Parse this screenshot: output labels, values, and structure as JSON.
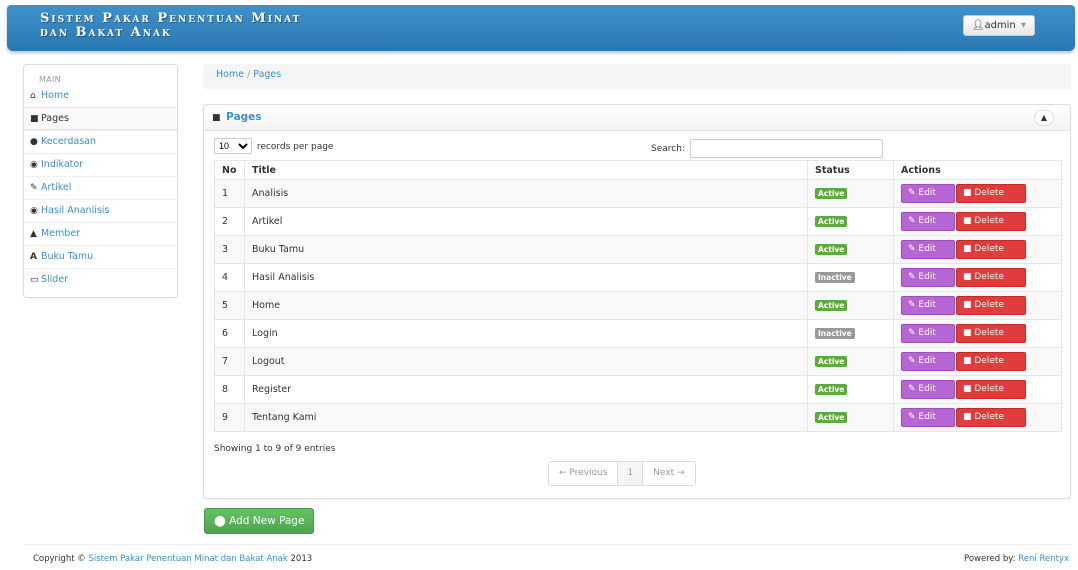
{
  "header": {
    "title_line1": "Sistem Pakar Penentuan Minat",
    "title_line2": "dan Bakat Anak",
    "user_label": "admin",
    "user_icon": "user-icon",
    "caret": "▾"
  },
  "sidebar": {
    "heading": "MAIN",
    "items": [
      {
        "label": "Home",
        "icon": "home-icon"
      },
      {
        "label": "Pages",
        "icon": "file-icon"
      },
      {
        "label": "Kecerdasan",
        "icon": "circle-icon"
      },
      {
        "label": "Indikator",
        "icon": "eye-slash-icon"
      },
      {
        "label": "Artikel",
        "icon": "pencil-icon"
      },
      {
        "label": "Hasil Ananlisis",
        "icon": "eye-icon"
      },
      {
        "label": "Member",
        "icon": "user-icon"
      },
      {
        "label": "Buku Tamu",
        "icon": "font-icon"
      },
      {
        "label": "Slider",
        "icon": "image-icon"
      }
    ]
  },
  "breadcrumb": {
    "home": "Home",
    "separator": "/",
    "current": "Pages"
  },
  "panel": {
    "title": "Pages",
    "length_value": "10",
    "length_label": "records per page",
    "search_label": "Search:",
    "search_value": "",
    "columns": [
      "No",
      "Title",
      "Status",
      "Actions"
    ],
    "rows": [
      {
        "no": "1",
        "title": "Analisis",
        "status": "Active"
      },
      {
        "no": "2",
        "title": "Artikel",
        "status": "Active"
      },
      {
        "no": "3",
        "title": "Buku Tamu",
        "status": "Active"
      },
      {
        "no": "4",
        "title": "Hasil Analisis",
        "status": "Inactive"
      },
      {
        "no": "5",
        "title": "Home",
        "status": "Active"
      },
      {
        "no": "6",
        "title": "Login",
        "status": "Inactive"
      },
      {
        "no": "7",
        "title": "Logout",
        "status": "Active"
      },
      {
        "no": "8",
        "title": "Register",
        "status": "Active"
      },
      {
        "no": "9",
        "title": "Tentang Kami",
        "status": "Active"
      }
    ],
    "edit_label": "Edit",
    "delete_label": "Delete",
    "info": "Showing 1 to 9 of 9 entries",
    "pager": {
      "previous": "← Previous",
      "page": "1",
      "next": "Next →"
    }
  },
  "add_button": "Add New Page",
  "footer": {
    "copyright_prefix": "Copyright ©",
    "copyright_link": "Sistem Pakar Penentuan Minat dan Bakat Anak",
    "copyright_year": "2013",
    "powered_prefix": "Powered by:",
    "powered_link": "Reni Rentyx"
  },
  "colors": {
    "header_bg": "#2f82bf",
    "link": "#3a8fd0",
    "active_badge": "#5cab3e",
    "inactive_badge": "#999999",
    "edit_button": "#b666d2",
    "delete_button": "#e23b3b",
    "add_button": "#5cb85c"
  }
}
